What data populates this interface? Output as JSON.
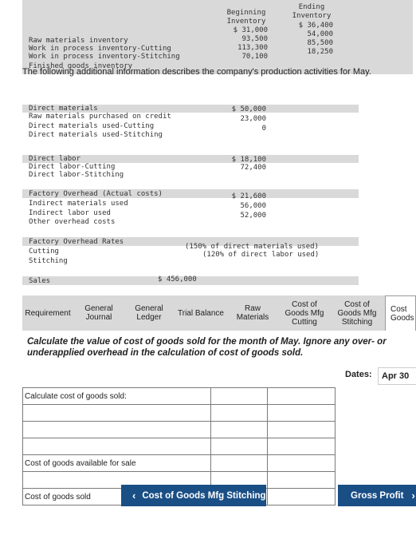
{
  "inventory": {
    "header_beginning": [
      "Beginning",
      "Inventory"
    ],
    "header_ending": [
      "Ending",
      "Inventory"
    ],
    "rows": [
      {
        "label": "Raw materials inventory",
        "beginning": "$ 31,000",
        "ending": "$ 36,400"
      },
      {
        "label": "Work in process inventory-Cutting",
        "beginning": "93,500",
        "ending": "54,000"
      },
      {
        "label": "Work in process inventory-Stitching",
        "beginning": "113,300",
        "ending": "85,500"
      },
      {
        "label": "Finished goods inventory",
        "beginning": "70,100",
        "ending": "18,250"
      }
    ]
  },
  "intro_text": "The following additional information describes the company's production activities for May.",
  "direct_materials": {
    "title": "Direct materials",
    "rows": [
      {
        "label": "Raw materials purchased on credit",
        "value": "$ 50,000"
      },
      {
        "label": "Direct materials used-Cutting",
        "value": "23,000"
      },
      {
        "label": "Direct materials used-Stitching",
        "value": "0"
      }
    ]
  },
  "direct_labor": {
    "title": "Direct labor",
    "rows": [
      {
        "label": "Direct labor-Cutting",
        "value": "$ 18,100"
      },
      {
        "label": "Direct labor-Stitching",
        "value": "72,400"
      }
    ]
  },
  "overhead_actual": {
    "title": "Factory Overhead (Actual costs)",
    "rows": [
      {
        "label": "Indirect materials used",
        "value": "$ 21,600"
      },
      {
        "label": "Indirect labor used",
        "value": "56,000"
      },
      {
        "label": "Other overhead costs",
        "value": "52,000"
      }
    ]
  },
  "overhead_rates": {
    "title": "Factory Overhead Rates",
    "rows": [
      {
        "label": "Cutting",
        "value": "(150% of direct materials used)"
      },
      {
        "label": "Stitching",
        "value": "(120% of direct labor used)"
      }
    ]
  },
  "sales": {
    "label": "Sales",
    "value": "$ 456,000"
  },
  "tabs": [
    {
      "lines": [
        "Requirement"
      ]
    },
    {
      "lines": [
        "General",
        "Journal"
      ]
    },
    {
      "lines": [
        "General",
        "Ledger"
      ]
    },
    {
      "lines": [
        "Trial Balance"
      ]
    },
    {
      "lines": [
        "Raw",
        "Materials"
      ]
    },
    {
      "lines": [
        "Cost of",
        "Goods Mfg",
        "Cutting"
      ]
    },
    {
      "lines": [
        "Cost of",
        "Goods Mfg",
        "Stitching"
      ]
    },
    {
      "lines": [
        "Cost",
        "Goods"
      ]
    }
  ],
  "instruction": "Calculate the value of cost of goods sold for the month of May. Ignore any over- or underapplied overhead in the calculation of cost of goods sold.",
  "dates": {
    "label": "Dates:",
    "value": "Apr 30"
  },
  "cogs_table": {
    "header": "Calculate cost of goods sold:",
    "available_label": "Cost of goods available for sale",
    "cogs_label": "Cost of goods sold"
  },
  "nav": {
    "prev_label": "Cost of Goods Mfg Stitching",
    "next_label": "Gross Profit"
  },
  "colors": {
    "button": "#1a4f86",
    "band": "#d9d9d9",
    "selected_tab": "#ffffff"
  }
}
